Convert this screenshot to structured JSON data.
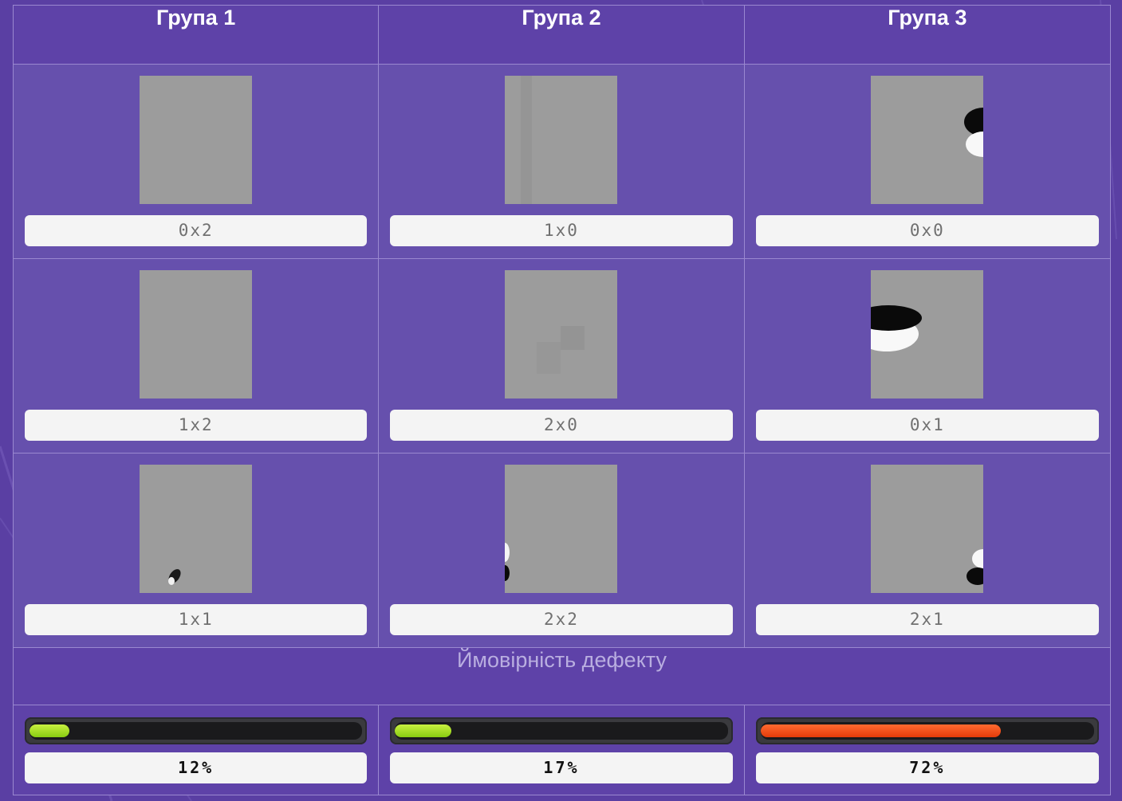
{
  "groups": [
    {
      "title": "Група 1",
      "tiles": [
        {
          "label": "0x2"
        },
        {
          "label": "1x2"
        },
        {
          "label": "1x1"
        }
      ],
      "probability": {
        "percent": 12,
        "text": "12%",
        "level": "low"
      }
    },
    {
      "title": "Група 2",
      "tiles": [
        {
          "label": "1x0"
        },
        {
          "label": "2x0"
        },
        {
          "label": "2x2"
        }
      ],
      "probability": {
        "percent": 17,
        "text": "17%",
        "level": "low"
      }
    },
    {
      "title": "Група 3",
      "tiles": [
        {
          "label": "0x0"
        },
        {
          "label": "0x1"
        },
        {
          "label": "2x1"
        }
      ],
      "probability": {
        "percent": 72,
        "text": "72%",
        "level": "high"
      }
    }
  ],
  "probability_title": "Ймовірність дефекту",
  "colors": {
    "background": "#5a3fa3",
    "cell": "#6650ad",
    "bar_low": "#a8e020",
    "bar_high": "#ff4a10"
  }
}
